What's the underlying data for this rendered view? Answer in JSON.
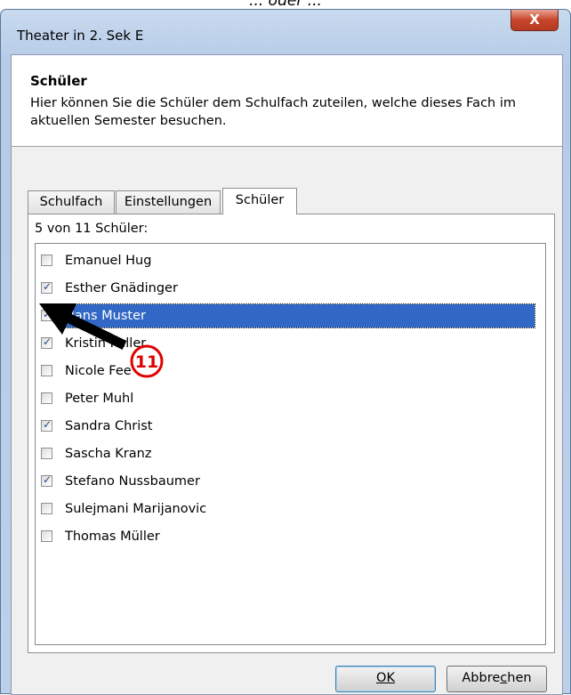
{
  "caption": "... oder ...",
  "window": {
    "title": "Theater in 2. Sek E",
    "close_label": "X"
  },
  "header": {
    "title": "Schüler",
    "description": "Hier können Sie die Schüler dem Schulfach zuteilen, welche dieses Fach im aktuellen Semester besuchen."
  },
  "tabs": [
    {
      "label": "Schulfach"
    },
    {
      "label": "Einstellungen"
    },
    {
      "label": "Schüler",
      "active": true
    }
  ],
  "count_label": "5 von 11 Schüler:",
  "students": [
    {
      "name": "Emanuel Hug",
      "checked": false
    },
    {
      "name": "Esther Gnädinger",
      "checked": true
    },
    {
      "name": "Hans Muster",
      "checked": true,
      "selected": true
    },
    {
      "name": "Kristin Keller",
      "checked": true
    },
    {
      "name": "Nicole Fee",
      "checked": false
    },
    {
      "name": "Peter Muhl",
      "checked": false
    },
    {
      "name": "Sandra Christ",
      "checked": true
    },
    {
      "name": "Sascha Kranz",
      "checked": false
    },
    {
      "name": "Stefano Nussbaumer",
      "checked": true
    },
    {
      "name": "Sulejmani Marijanovic",
      "checked": false
    },
    {
      "name": "Thomas Müller",
      "checked": false
    }
  ],
  "buttons": {
    "ok_label": "OK",
    "cancel_label_pre": "Abbre",
    "cancel_label_ul": "c",
    "cancel_label_post": "hen"
  },
  "annotation": {
    "number": "11",
    "color": "#e00000"
  },
  "colors": {
    "selection": "#3168c6",
    "close_button": "#c7452b"
  }
}
